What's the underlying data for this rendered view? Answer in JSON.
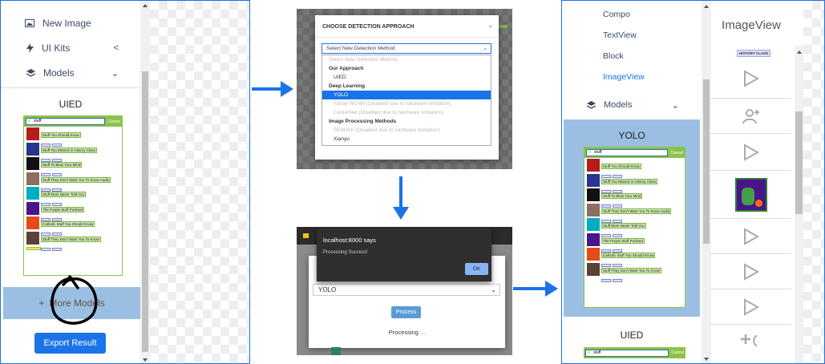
{
  "panel_left": {
    "nav_items": [
      {
        "label": "New Image",
        "icon": "image-icon"
      },
      {
        "label": "UI Kits",
        "icon": "bolt-icon",
        "chevron": "<"
      },
      {
        "label": "Models",
        "icon": "layers-icon",
        "chevron": "⌄"
      }
    ],
    "section_title": "UIED",
    "more_models_label": "More Models",
    "export_label": "Export Result"
  },
  "phone_preview": {
    "search_text": "stuff",
    "cancel_label": "Cancel",
    "rows": [
      {
        "title": "Stuff You Should Know",
        "color": "#b71c1c"
      },
      {
        "title": "Stuff You Missed in History Class",
        "color": "#283593"
      },
      {
        "title": "Stuff To Blow Your Mind",
        "color": "#111111"
      },
      {
        "title": "Stuff They Don't Want You To Know Audio",
        "color": "#8d6e63"
      },
      {
        "title": "Stuff Mom Never Told You",
        "color": "#00acc1"
      },
      {
        "title": "The Purple Stuff Podcast",
        "color": "#4a148c"
      },
      {
        "title": "Catholic Stuff You Should Know",
        "color": "#e64a19"
      },
      {
        "title": "Stuff They Don't Want You To Know",
        "color": "#5d4037"
      }
    ]
  },
  "detection_modal": {
    "title": "CHOOSE DETECTION APPROACH",
    "close": "×",
    "select_value": "Select New Detection Method",
    "options": [
      {
        "label": "Select New Detection Method",
        "kind": "dis0"
      },
      {
        "label": "Our Approach",
        "kind": "grp"
      },
      {
        "label": "UIED",
        "kind": "en"
      },
      {
        "label": "Deep Learning",
        "kind": "grp"
      },
      {
        "label": "YOLO",
        "kind": "sel"
      },
      {
        "label": "Faster RCNN (Disabled due to hardware limitation)",
        "kind": "dis"
      },
      {
        "label": "CenterNet (Disabled due to hardware limitation)",
        "kind": "dis"
      },
      {
        "label": "Image Processing Methods",
        "kind": "grp"
      },
      {
        "label": "REMAUI (Disabled due to hardware limitation)",
        "kind": "dis"
      },
      {
        "label": "Xianyu",
        "kind": "en"
      }
    ]
  },
  "process_modal": {
    "alert_host": "localhost:8000 says",
    "alert_message": "Processing Success!",
    "ok_label": "OK",
    "select_value": "YOLO",
    "process_label": "Process",
    "status": "Processing ..."
  },
  "panel_right": {
    "nav_items": [
      {
        "label": "Compo"
      },
      {
        "label": "TextView"
      },
      {
        "label": "Block"
      },
      {
        "label": "ImageView",
        "active": true
      }
    ],
    "models_label": "Models",
    "models_chevron": "⌄",
    "yolo_title": "YOLO",
    "uied_title": "UIED",
    "search_text": "stuff",
    "cancel_label": "Cancel",
    "imageview_header": "ImageView",
    "imageview_badge": "HISTORY CLASS"
  },
  "colors": {
    "accent": "#1a73e8",
    "highlight": "#9bbfe3",
    "green": "#8bc34a"
  }
}
